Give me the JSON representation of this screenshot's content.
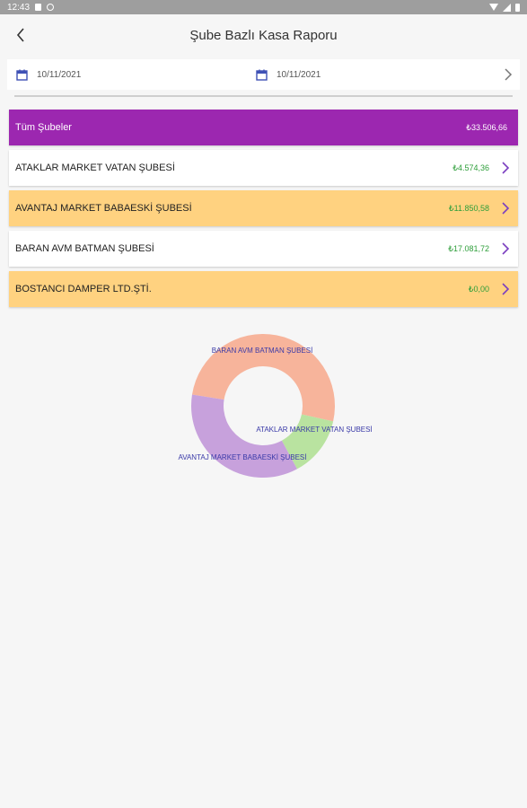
{
  "status": {
    "time": "12:43"
  },
  "appbar": {
    "title": "Şube Bazlı Kasa Raporu"
  },
  "dates": {
    "start": "10/11/2021",
    "end": "10/11/2021"
  },
  "summary": {
    "label": "Tüm Şubeler",
    "amount": "₺33.506,66"
  },
  "branches": [
    {
      "name": "ATAKLAR MARKET VATAN ŞUBESİ",
      "amount": "₺4.574,36",
      "style": "white"
    },
    {
      "name": "AVANTAJ MARKET BABAESKİ ŞUBESİ",
      "amount": "₺11.850,58",
      "style": "orange"
    },
    {
      "name": "BARAN AVM BATMAN ŞUBESİ",
      "amount": "₺17.081,72",
      "style": "white"
    },
    {
      "name": "BOSTANCI DAMPER LTD.ŞTİ.",
      "amount": "₺0,00",
      "style": "orange"
    }
  ],
  "chart_data": {
    "type": "pie",
    "title": "",
    "donut": true,
    "slices": [
      {
        "label": "BARAN AVM BATMAN ŞUBESİ",
        "value": 17081.72,
        "color": "#f7b49b"
      },
      {
        "label": "ATAKLAR MARKET VATAN ŞUBESİ",
        "value": 4574.36,
        "color": "#b9e3a0"
      },
      {
        "label": "AVANTAJ MARKET BABAESKİ ŞUBESİ",
        "value": 11850.58,
        "color": "#c7a1dc"
      }
    ],
    "label_color": "#3a3aa8"
  },
  "colors": {
    "accent": "#9c27b0",
    "orange_row": "#ffd280",
    "amount_green": "#2e9e3a",
    "chevron": "#7b3fc0",
    "calendar_icon": "#3f51b5"
  }
}
